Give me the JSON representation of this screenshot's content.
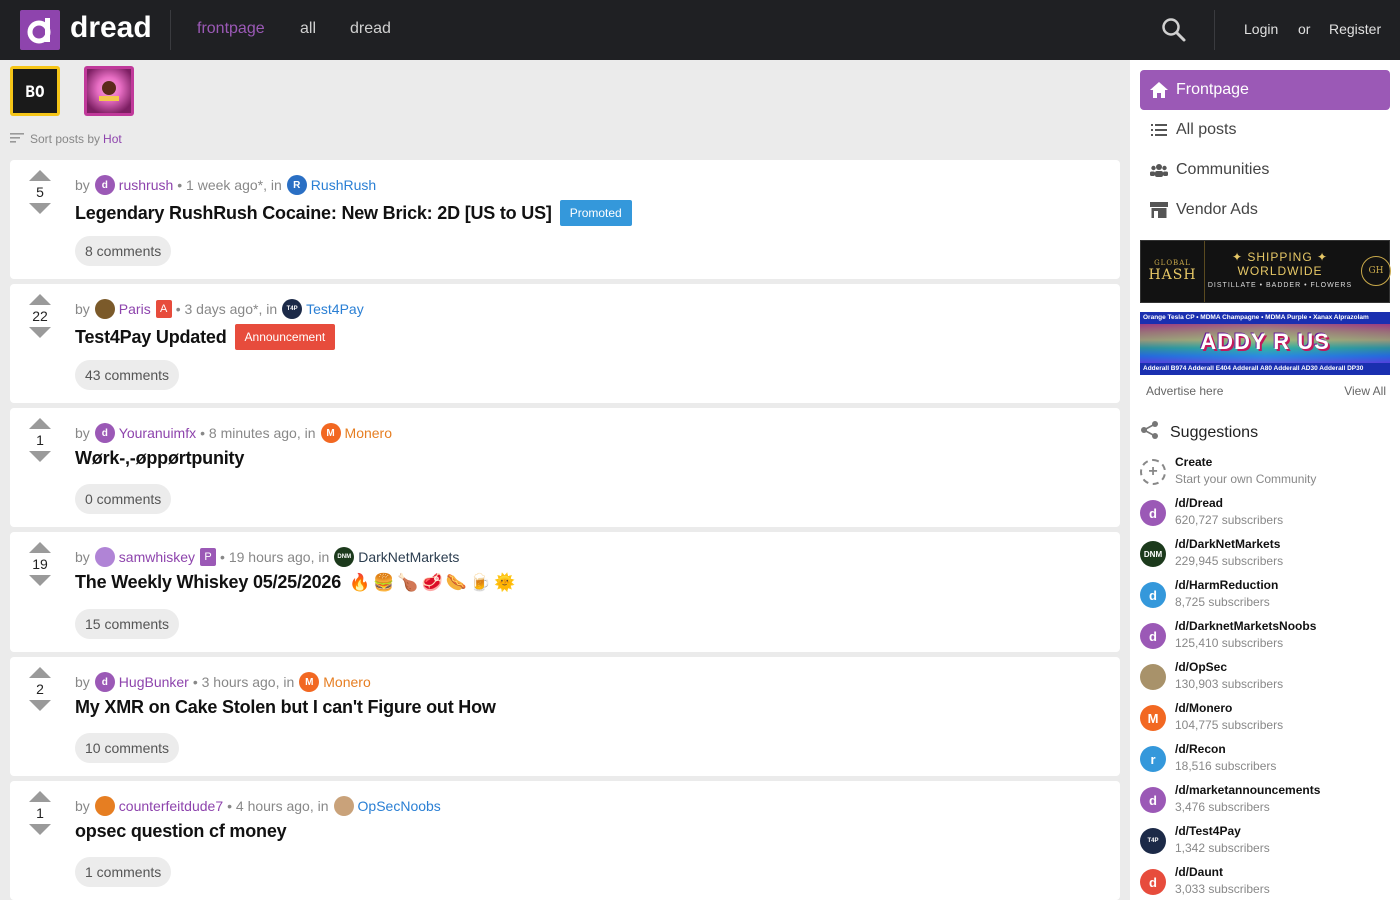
{
  "header": {
    "logo_letter": "d",
    "site_name": "dread",
    "nav": [
      "frontpage",
      "all",
      "dread"
    ],
    "login": "Login",
    "or": "or",
    "register": "Register"
  },
  "sort": {
    "label": "Sort posts by",
    "value": "Hot"
  },
  "badges": {
    "first": "BO"
  },
  "posts": [
    {
      "votes": "5",
      "by": "by",
      "user": "rushrush",
      "time": "• 1 week ago*, in",
      "community": "RushRush",
      "title": "Legendary RushRush Cocaine: New Brick: 2D [US to US]",
      "tag": "Promoted",
      "comments": "8 comments"
    },
    {
      "votes": "22",
      "by": "by",
      "user": "Paris",
      "user_badge": "A",
      "time": "• 3 days ago*, in",
      "community": "Test4Pay",
      "title": "Test4Pay Updated",
      "tag": "Announcement",
      "comments": "43 comments"
    },
    {
      "votes": "1",
      "by": "by",
      "user": "Youranuimfx",
      "time": "• 8 minutes ago, in",
      "community": "Monero",
      "title": "Wørk-,-øppørtpunity",
      "comments": "0 comments"
    },
    {
      "votes": "19",
      "by": "by",
      "user": "samwhiskey",
      "user_badge": "P",
      "time": "• 19 hours ago, in",
      "community": "DarkNetMarkets",
      "title": "The Weekly Whiskey 05/25/2026",
      "emojis": "🔥🍔🍗🥩🌭🍺🌞",
      "comments": "15 comments"
    },
    {
      "votes": "2",
      "by": "by",
      "user": "HugBunker",
      "time": "• 3 hours ago, in",
      "community": "Monero",
      "title": "My XMR on Cake Stolen but I can't Figure out How",
      "comments": "10 comments"
    },
    {
      "votes": "1",
      "by": "by",
      "user": "counterfeitdude7",
      "time": "• 4 hours ago, in",
      "community": "OpSecNoobs",
      "title": "opsec question cf money",
      "comments": "1 comments"
    }
  ],
  "sidebar": {
    "nav": [
      "Frontpage",
      "All posts",
      "Communities",
      "Vendor Ads"
    ],
    "ad1": {
      "left_top": "GLOBAL",
      "left_bottom": "HASH",
      "mid_top": "✦ SHIPPING ✦",
      "mid_mid": "WORLDWIDE",
      "mid_bottom": "DISTILLATE • BADDER • FLOWERS",
      "right": "GH"
    },
    "ad2": {
      "top": "Orange Tesla CP • MDMA Champagne • MDMA Purple • Xanax Alprazolam",
      "brand": "ADDY R US",
      "bottom": "Adderall B974  Adderall E404  Adderall A80  Adderall AD30  Adderall DP30"
    },
    "advertise": "Advertise here",
    "view_all": "View All",
    "suggestions_title": "Suggestions",
    "suggestions": [
      {
        "name": "Create",
        "sub": "Start your own Community"
      },
      {
        "name": "/d/Dread",
        "sub": "620,727 subscribers"
      },
      {
        "name": "/d/DarkNetMarkets",
        "sub": "229,945 subscribers"
      },
      {
        "name": "/d/HarmReduction",
        "sub": "8,725 subscribers"
      },
      {
        "name": "/d/DarknetMarketsNoobs",
        "sub": "125,410 subscribers"
      },
      {
        "name": "/d/OpSec",
        "sub": "130,903 subscribers"
      },
      {
        "name": "/d/Monero",
        "sub": "104,775 subscribers"
      },
      {
        "name": "/d/Recon",
        "sub": "18,516 subscribers"
      },
      {
        "name": "/d/marketannouncements",
        "sub": "3,476 subscribers"
      },
      {
        "name": "/d/Test4Pay",
        "sub": "1,342 subscribers"
      },
      {
        "name": "/d/Daunt",
        "sub": "3,033 subscribers"
      }
    ]
  },
  "colors": {
    "accent": "#9b59b6",
    "header_bg": "#1f2023",
    "promoted": "#3498db",
    "announcement": "#e74c3c"
  }
}
